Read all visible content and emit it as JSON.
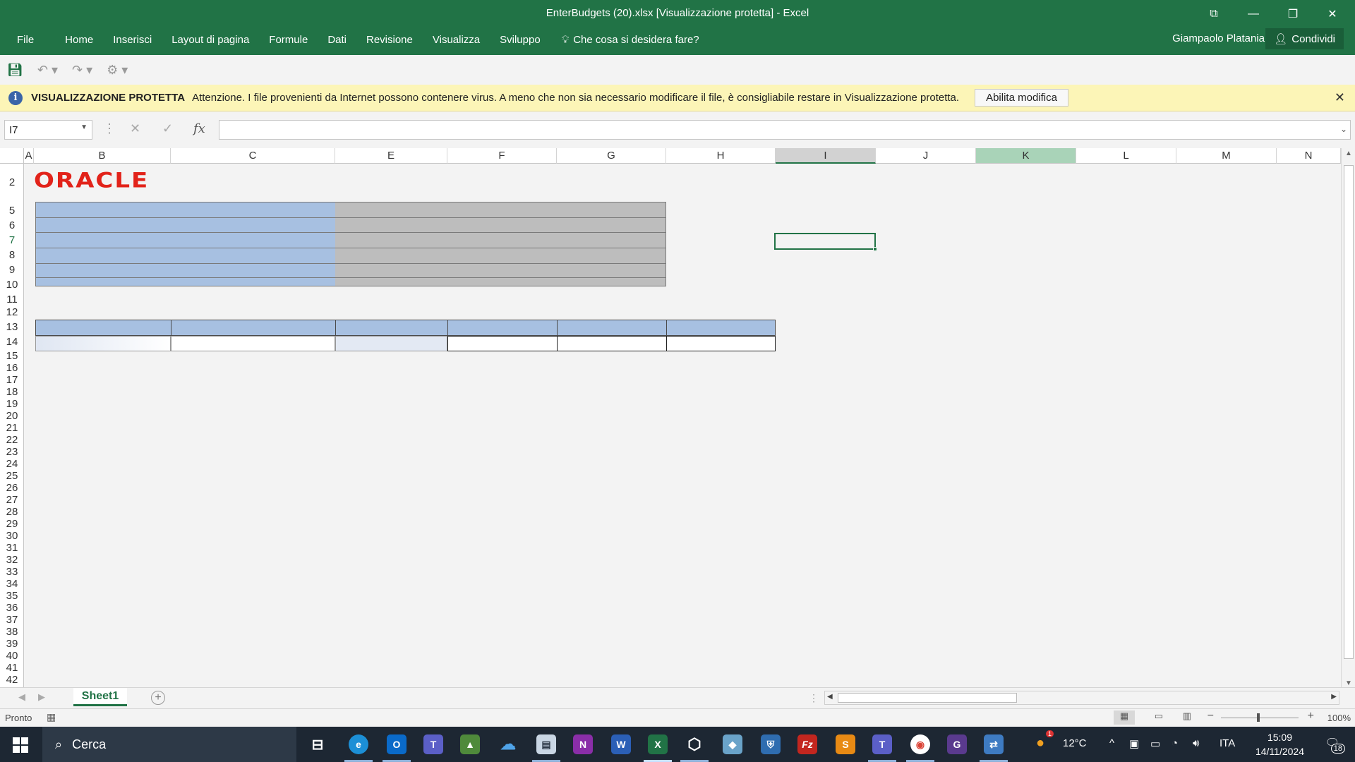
{
  "window": {
    "title": "EnterBudgets (20).xlsx  [Visualizzazione protetta] - Excel"
  },
  "ribbon": {
    "tabs": [
      "File",
      "Home",
      "Inserisci",
      "Layout di pagina",
      "Formule",
      "Dati",
      "Revisione",
      "Visualizza",
      "Sviluppo"
    ],
    "tell_me": "Che cosa si desidera fare?",
    "user": "Giampaolo Platania",
    "share": "Condividi"
  },
  "protected_view": {
    "title": "VISUALIZZAZIONE PROTETTA",
    "message": "Attenzione. I file provenienti da Internet possono contenere virus. A meno che non sia necessario modificare il file, è consigliabile restare in Visualizzazione protetta.",
    "enable_button": "Abilita modifica"
  },
  "formula_bar": {
    "name_box": "I7",
    "fx": "fx",
    "formula": ""
  },
  "grid": {
    "columns": [
      "A",
      "B",
      "C",
      "E",
      "F",
      "G",
      "H",
      "I",
      "J",
      "K",
      "L",
      "M",
      "N"
    ],
    "rows": [
      "2",
      "5",
      "6",
      "7",
      "8",
      "9",
      "10",
      "11",
      "12",
      "13",
      "14",
      "15",
      "16",
      "17",
      "18",
      "19",
      "20",
      "21",
      "22",
      "23",
      "24",
      "25",
      "26",
      "27",
      "28",
      "29",
      "30",
      "31",
      "32",
      "33",
      "34",
      "35",
      "36",
      "37",
      "38",
      "39",
      "40",
      "41",
      "42"
    ],
    "selected_column": "I",
    "selected_row": "7",
    "logo_text": "ORACLE"
  },
  "sheets": {
    "tabs": [
      "Sheet1"
    ],
    "active": "Sheet1"
  },
  "status_bar": {
    "status": "Pronto",
    "zoom": "100%"
  },
  "taskbar": {
    "search": "Cerca",
    "temperature": "12°C",
    "language": "ITA",
    "time": "15:09",
    "date": "14/11/2024",
    "weather_badge": "1",
    "notifications": "18"
  },
  "colors": {
    "excel_green": "#217346",
    "header_blue": "#a7c0e1",
    "header_grey": "#bdbdbd",
    "oracle_red": "#e2231a",
    "protected_bar": "#fcf5b7"
  }
}
